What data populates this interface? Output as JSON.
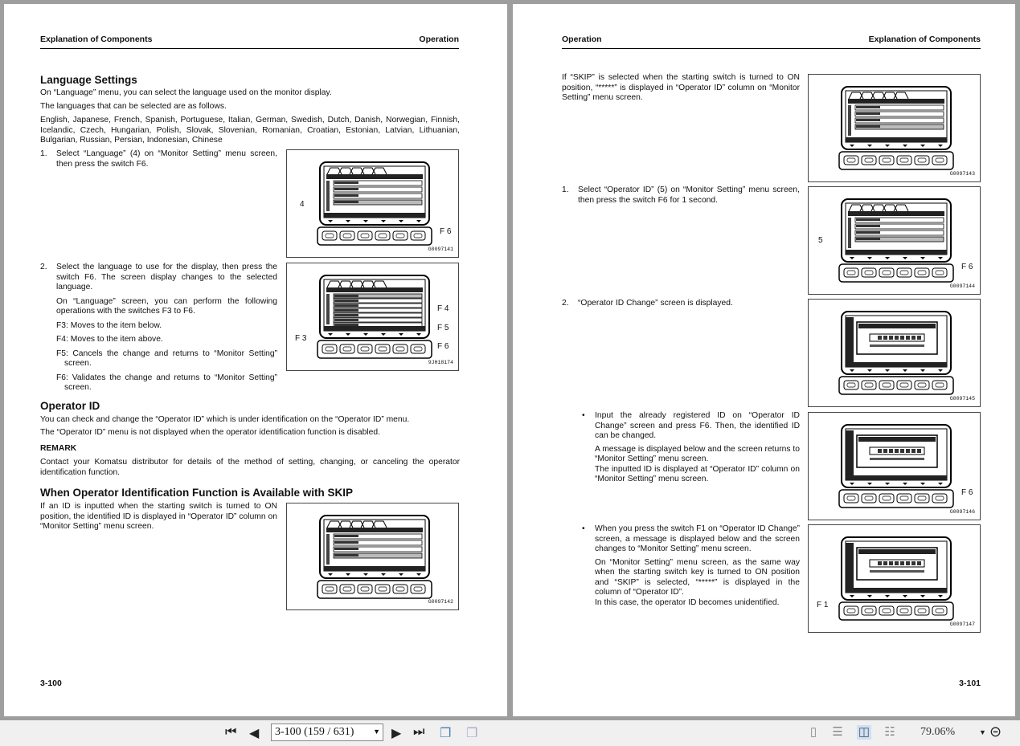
{
  "left_page": {
    "header_left": "Explanation of Components",
    "header_right": "Operation",
    "footer": "3-100",
    "lang_heading": "Language Settings",
    "lang_p1": "On “Language” menu, you can select the language used on the monitor display.",
    "lang_p2": "The languages that can be selected are as follows.",
    "lang_list": "English, Japanese, French, Spanish, Portuguese, Italian, German, Swedish, Dutch, Danish, Norwegian, Finnish, Icelandic, Czech, Hungarian, Polish, Slovak, Slovenian, Romanian, Croatian, Estonian, Latvian, Lithuanian, Bulgarian, Russian, Persian, Indonesian, Chinese",
    "step1_num": "1.",
    "step1": "Select “Language” (4) on “Monitor Setting” menu screen, then press the switch F6.",
    "step2_num": "2.",
    "step2": "Select the language to use for the display, then press the switch F6. The screen display changes to the selected language.",
    "step2_b": "On “Language” screen, you can perform the following operations with the switches F3 to F6.",
    "f3": "F3: Moves to the item below.",
    "f4": "F4: Moves to the item above.",
    "f5": "F5: Cancels the change and returns to “Monitor Setting” screen.",
    "f6": "F6: Validates the change and returns to “Monitor Setting” screen.",
    "op_heading": "Operator ID",
    "op_p1": "You can check and change the “Operator ID” which is under identification on the “Operator ID” menu.",
    "op_p2": "The “Operator ID” menu is not displayed when the operator identification function is disabled.",
    "remark_label": "REMARK",
    "remark": "Contact your Komatsu distributor for details of the method of setting, changing, or canceling the operator identification function.",
    "skip_heading": "When Operator Identification Function is Available with SKIP",
    "skip_p": "If an ID is inputted when the starting switch is turned to ON position, the identified ID is displayed in “Operator ID” column on “Monitor Setting” menu screen.",
    "figures": [
      {
        "caption": "G0097141",
        "callouts": [
          "4",
          "F 6"
        ]
      },
      {
        "caption": "9JH18174",
        "callouts": [
          "F 4",
          "F 5",
          "F 6",
          "F 3"
        ]
      },
      {
        "caption": "G0097142",
        "callouts": []
      }
    ]
  },
  "right_page": {
    "header_left": "Operation",
    "header_right": "Explanation of Components",
    "footer": "3-101",
    "skip_p": "If “SKIP” is selected when the starting switch is turned to ON position, “*****” is displayed in “Operator ID” column on “Monitor Setting” menu screen.",
    "step1_num": "1.",
    "step1": "Select “Operator ID” (5) on “Monitor Setting” menu screen, then press the switch F6 for 1 second.",
    "step2_num": "2.",
    "step2": "“Operator ID Change” screen is displayed.",
    "bullet1": "Input the already registered ID on “Operator ID Change” screen and press F6. Then, the identified ID can be changed.",
    "bullet1_b": "A message is displayed below and the screen returns to “Monitor Setting” menu screen.",
    "bullet1_c": "The inputted ID is displayed at “Operator ID” column on “Monitor Setting” menu screen.",
    "bullet2": "When you press the switch F1 on “Operator ID Change” screen, a message is displayed below and the screen changes to “Monitor Setting” menu screen.",
    "bullet2_b": "On “Monitor Setting” menu screen, as the same way when the starting switch key is turned to ON position and “SKIP” is selected, “*****” is displayed in the column of “Operator ID”.",
    "bullet2_c": "In this case, the operator ID becomes unidentified.",
    "bullet_char": "•",
    "figures": [
      {
        "caption": "G0097143",
        "callouts": []
      },
      {
        "caption": "G0097144",
        "callouts": [
          "5",
          "F 6"
        ]
      },
      {
        "caption": "G0097145",
        "callouts": []
      },
      {
        "caption": "G0097146",
        "callouts": [
          "F 6"
        ]
      },
      {
        "caption": "G0097147",
        "callouts": [
          "F 1"
        ]
      }
    ]
  },
  "toolbar": {
    "page_field": "3-100 (159 / 631)",
    "zoom": "79.06%",
    "icons": [
      "first-page-icon",
      "prev-page-icon",
      "next-page-icon",
      "last-page-icon",
      "back-view-icon",
      "forward-view-icon",
      "single-page-icon",
      "continuous-icon",
      "facing-icon",
      "continuous-facing-icon",
      "zoom-out-icon"
    ]
  }
}
